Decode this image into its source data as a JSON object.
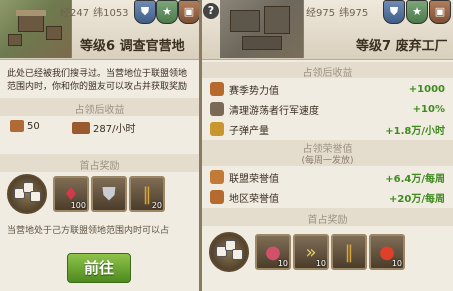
{
  "left": {
    "help_icon": "?",
    "coords": {
      "jing": "经247",
      "wei": "纬1053"
    },
    "title": "等级6 调查官营地",
    "description": "此处已经被我们搜寻过。当营地位于联盟领地范围内时，你和你的盟友可以攻占并获取奖励",
    "occupy_section": "占领后收益",
    "resources": [
      {
        "icon": "stone-icon",
        "value": "50"
      },
      {
        "icon": "wood-icon",
        "value": "287/小时"
      }
    ],
    "first_reward_section": "首占奖励",
    "reward_slots": [
      {
        "icon": "gem-icon",
        "glyph": "♦",
        "count": "100"
      },
      {
        "icon": "shield-icon",
        "glyph": "⛊",
        "count": ""
      },
      {
        "icon": "bullets-icon",
        "glyph": "‖",
        "count": "20"
      }
    ],
    "note": "当营地处于己方联盟领地范围内时可以占",
    "go_button": "前往"
  },
  "right": {
    "help_icon": "?",
    "coords": {
      "jing": "经975",
      "wei": "纬975"
    },
    "title": "等级7 废弃工厂",
    "occupy_section": "占领后收益",
    "gains": [
      {
        "icon": "season-power-icon",
        "label": "赛季势力值",
        "value": "+1000"
      },
      {
        "icon": "clear-speed-icon",
        "label": "清理游荡者行军速度",
        "value": "+10%"
      },
      {
        "icon": "bullets-icon",
        "label": "子弹产量",
        "value": "+1.8万/小时"
      }
    ],
    "honor_section": "占领荣誉值",
    "honor_sub": "(每周一发放)",
    "honors": [
      {
        "icon": "alliance-honor-icon",
        "label": "联盟荣誉值",
        "value": "+6.4万/每周"
      },
      {
        "icon": "region-honor-icon",
        "label": "地区荣誉值",
        "value": "+20万/每周"
      }
    ],
    "first_reward_section": "首占奖励",
    "reward_slots": [
      {
        "icon": "meat-icon",
        "glyph": "●",
        "count": "10"
      },
      {
        "icon": "speedup-icon",
        "glyph": "»",
        "count": "10"
      },
      {
        "icon": "bullets-icon",
        "glyph": "‖",
        "count": ""
      },
      {
        "icon": "tomato-icon",
        "glyph": "●",
        "count": "10"
      }
    ]
  }
}
